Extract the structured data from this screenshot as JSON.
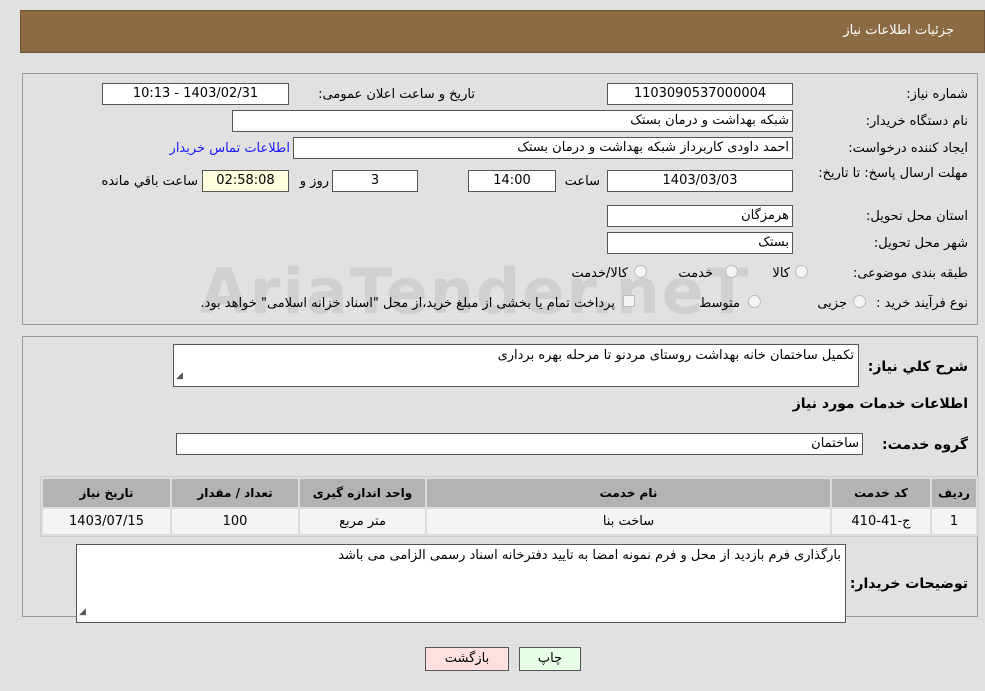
{
  "header": {
    "title": "جزئیات اطلاعات نیاز"
  },
  "watermark": "AriaTender.neT",
  "form": {
    "need_number_label": "شماره نیاز:",
    "need_number": "1103090537000004",
    "announce_label": "تاریخ و ساعت اعلان عمومی:",
    "announce_value": "1403/02/31 - 10:13",
    "buyer_org_label": "نام دستگاه خریدار:",
    "buyer_org": "شبکه بهداشت و درمان بستک",
    "creator_label": "ایجاد کننده درخواست:",
    "creator": "احمد داودی کاربرداز شبکه بهداشت و درمان بستک",
    "contact_link": "اطلاعات تماس خریدار",
    "deadline_label": "مهلت ارسال پاسخ: تا تاریخ:",
    "deadline_date": "1403/03/03",
    "time_label": "ساعت",
    "deadline_time": "14:00",
    "days": "3",
    "days_label": "روز و",
    "remaining": "02:58:08",
    "remaining_label": "ساعت باقي مانده",
    "province_label": "استان محل تحویل:",
    "province": "هرمزگان",
    "city_label": "شهر محل تحویل:",
    "city": "بستک",
    "category_label": "طبقه بندی موضوعی:",
    "category_options": [
      "كالا",
      "خدمت",
      "كالا/خدمت"
    ],
    "process_label": "نوع فرآیند خرید :",
    "process_options": [
      "جزیی",
      "متوسط"
    ],
    "payment_note": "پرداخت تمام یا بخشی از مبلغ خرید،از محل \"اسناد خزانه اسلامی\" خواهد بود."
  },
  "details": {
    "summary_label": "شرح کلي نیاز:",
    "summary": "تکمیل ساختمان خانه بهداشت روستای مردنو تا مرحله بهره برداری",
    "services_title": "اطلاعات خدمات مورد نیاز",
    "group_label": "گروه خدمت:",
    "group": "ساختمان",
    "table": {
      "headers": [
        "ردیف",
        "کد خدمت",
        "نام خدمت",
        "واحد اندازه گیری",
        "تعداد / مقدار",
        "تاریخ نیاز"
      ],
      "rows": [
        [
          "1",
          "ج-41-410",
          "ساخت بنا",
          "متر مربع",
          "100",
          "1403/07/15"
        ]
      ]
    },
    "notes_label": "توضیحات خریدار:",
    "notes": "بارگذاری فرم بازدید از محل و فرم نمونه امضا به تایید دفترخانه اسناد رسمی الزامی می باشد"
  },
  "buttons": {
    "print": "چاپ",
    "back": "بازگشت"
  }
}
